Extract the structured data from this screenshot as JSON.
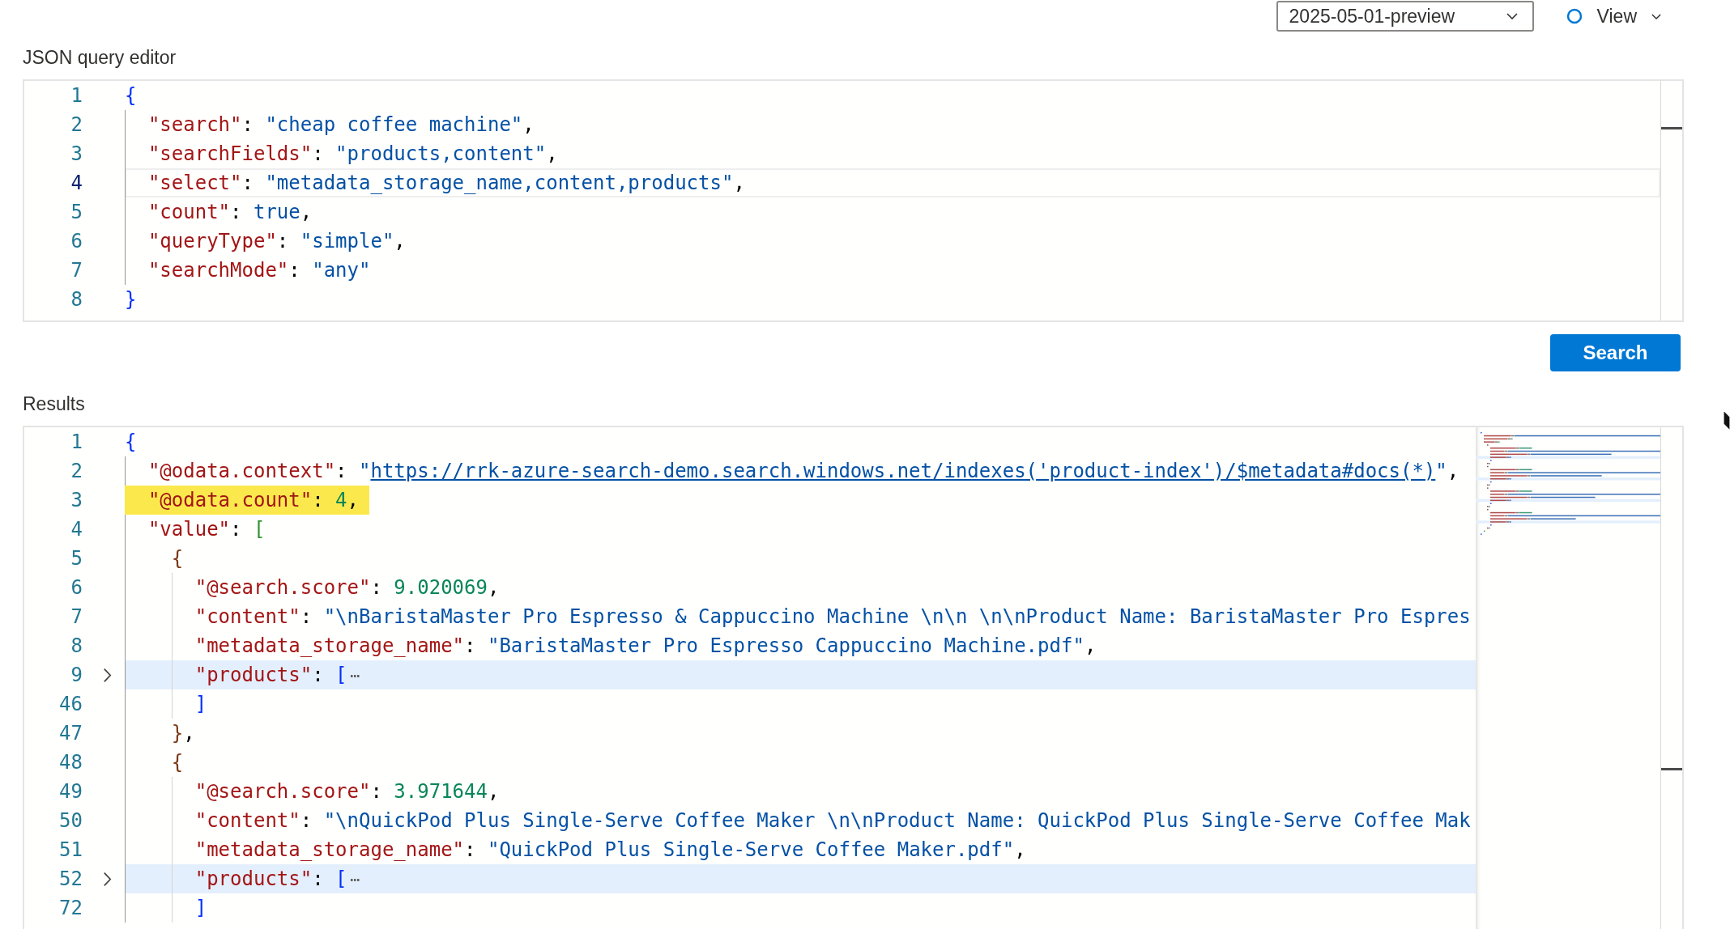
{
  "toolbar": {
    "api_version_dropdown": {
      "value": "2025-05-01-preview"
    },
    "view_menu": {
      "label": "View"
    }
  },
  "query_editor": {
    "label": "JSON query editor",
    "lines": [
      {
        "number": "1",
        "current": false,
        "tokens": [
          {
            "kind": "bracket",
            "text": "{",
            "color": "#0431fa"
          }
        ]
      },
      {
        "number": "2",
        "current": false,
        "tokens": [
          {
            "kind": "key",
            "text": "  \"search\""
          },
          {
            "kind": "punct",
            "text": ": "
          },
          {
            "kind": "string",
            "text": "\"cheap coffee machine\""
          },
          {
            "kind": "punct",
            "text": ","
          }
        ]
      },
      {
        "number": "3",
        "current": false,
        "tokens": [
          {
            "kind": "key",
            "text": "  \"searchFields\""
          },
          {
            "kind": "punct",
            "text": ": "
          },
          {
            "kind": "string",
            "text": "\"products,content\""
          },
          {
            "kind": "punct",
            "text": ","
          }
        ]
      },
      {
        "number": "4",
        "current": true,
        "tokens": [
          {
            "kind": "key",
            "text": "  \"select\""
          },
          {
            "kind": "punct",
            "text": ": "
          },
          {
            "kind": "string",
            "text": "\"metadata_storage_name,content,products\""
          },
          {
            "kind": "punct",
            "text": ","
          }
        ]
      },
      {
        "number": "5",
        "current": false,
        "tokens": [
          {
            "kind": "key",
            "text": "  \"count\""
          },
          {
            "kind": "punct",
            "text": ": "
          },
          {
            "kind": "keyword",
            "text": "true"
          },
          {
            "kind": "punct",
            "text": ","
          }
        ]
      },
      {
        "number": "6",
        "current": false,
        "tokens": [
          {
            "kind": "key",
            "text": "  \"queryType\""
          },
          {
            "kind": "punct",
            "text": ": "
          },
          {
            "kind": "string",
            "text": "\"simple\""
          },
          {
            "kind": "punct",
            "text": ","
          }
        ]
      },
      {
        "number": "7",
        "current": false,
        "tokens": [
          {
            "kind": "key",
            "text": "  \"searchMode\""
          },
          {
            "kind": "punct",
            "text": ": "
          },
          {
            "kind": "string",
            "text": "\"any\""
          }
        ]
      },
      {
        "number": "8",
        "current": false,
        "tokens": [
          {
            "kind": "bracket",
            "text": "}",
            "color": "#0431fa"
          }
        ]
      }
    ]
  },
  "search_button": {
    "label": "Search"
  },
  "results": {
    "label": "Results",
    "lines": [
      {
        "number": "1",
        "folded": false,
        "highlighted": false,
        "tokens": [
          {
            "kind": "bracket",
            "text": "{",
            "color": "#0431fa"
          }
        ]
      },
      {
        "number": "2",
        "folded": false,
        "highlighted": false,
        "tokens": [
          {
            "kind": "key",
            "text": "  \"@odata.context\""
          },
          {
            "kind": "punct",
            "text": ": "
          },
          {
            "kind": "string",
            "text": "\""
          },
          {
            "kind": "link",
            "text": "https://rrk-azure-search-demo.search.windows.net/indexes('product-index')/$metadata#docs(*)"
          },
          {
            "kind": "string",
            "text": "\""
          },
          {
            "kind": "punct",
            "text": ","
          }
        ]
      },
      {
        "number": "3",
        "folded": false,
        "highlighted": true,
        "tokens": [
          {
            "kind": "key",
            "text": "  \"@odata.count\""
          },
          {
            "kind": "punct",
            "text": ": "
          },
          {
            "kind": "number",
            "text": "4"
          },
          {
            "kind": "punct",
            "text": ","
          }
        ]
      },
      {
        "number": "4",
        "folded": false,
        "highlighted": false,
        "tokens": [
          {
            "kind": "key",
            "text": "  \"value\""
          },
          {
            "kind": "punct",
            "text": ": "
          },
          {
            "kind": "bracket",
            "text": "[",
            "color": "#319331"
          }
        ]
      },
      {
        "number": "5",
        "folded": false,
        "highlighted": false,
        "tokens": [
          {
            "kind": "bracket",
            "text": "    {",
            "color": "#7b3814"
          }
        ]
      },
      {
        "number": "6",
        "folded": false,
        "highlighted": false,
        "tokens": [
          {
            "kind": "key",
            "text": "      \"@search.score\""
          },
          {
            "kind": "punct",
            "text": ": "
          },
          {
            "kind": "number",
            "text": "9.020069"
          },
          {
            "kind": "punct",
            "text": ","
          }
        ]
      },
      {
        "number": "7",
        "folded": false,
        "highlighted": false,
        "tokens": [
          {
            "kind": "key",
            "text": "      \"content\""
          },
          {
            "kind": "punct",
            "text": ": "
          },
          {
            "kind": "string",
            "text": "\"\\nBaristaMaster Pro Espresso & Cappuccino Machine \\n\\n \\n\\nProduct Name: BaristaMaster Pro Espres"
          }
        ]
      },
      {
        "number": "8",
        "folded": false,
        "highlighted": false,
        "tokens": [
          {
            "kind": "key",
            "text": "      \"metadata_storage_name\""
          },
          {
            "kind": "punct",
            "text": ": "
          },
          {
            "kind": "string",
            "text": "\"BaristaMaster Pro Espresso Cappuccino Machine.pdf\""
          },
          {
            "kind": "punct",
            "text": ","
          }
        ]
      },
      {
        "number": "9",
        "folded": true,
        "highlighted": false,
        "tokens": [
          {
            "kind": "key",
            "text": "      \"products\""
          },
          {
            "kind": "punct",
            "text": ": "
          },
          {
            "kind": "bracket",
            "text": "[",
            "color": "#0431fa"
          },
          {
            "kind": "fold",
            "text": "⋯"
          }
        ]
      },
      {
        "number": "46",
        "folded": false,
        "highlighted": false,
        "tokens": [
          {
            "kind": "bracket",
            "text": "      ]",
            "color": "#0431fa"
          }
        ]
      },
      {
        "number": "47",
        "folded": false,
        "highlighted": false,
        "tokens": [
          {
            "kind": "bracket",
            "text": "    }",
            "color": "#7b3814"
          },
          {
            "kind": "punct",
            "text": ","
          }
        ]
      },
      {
        "number": "48",
        "folded": false,
        "highlighted": false,
        "tokens": [
          {
            "kind": "bracket",
            "text": "    {",
            "color": "#7b3814"
          }
        ]
      },
      {
        "number": "49",
        "folded": false,
        "highlighted": false,
        "tokens": [
          {
            "kind": "key",
            "text": "      \"@search.score\""
          },
          {
            "kind": "punct",
            "text": ": "
          },
          {
            "kind": "number",
            "text": "3.971644"
          },
          {
            "kind": "punct",
            "text": ","
          }
        ]
      },
      {
        "number": "50",
        "folded": false,
        "highlighted": false,
        "tokens": [
          {
            "kind": "key",
            "text": "      \"content\""
          },
          {
            "kind": "punct",
            "text": ": "
          },
          {
            "kind": "string",
            "text": "\"\\nQuickPod Plus Single-Serve Coffee Maker \\n\\nProduct Name: QuickPod Plus Single-Serve Coffee Mak"
          }
        ]
      },
      {
        "number": "51",
        "folded": false,
        "highlighted": false,
        "tokens": [
          {
            "kind": "key",
            "text": "      \"metadata_storage_name\""
          },
          {
            "kind": "punct",
            "text": ": "
          },
          {
            "kind": "string",
            "text": "\"QuickPod Plus Single-Serve Coffee Maker.pdf\""
          },
          {
            "kind": "punct",
            "text": ","
          }
        ]
      },
      {
        "number": "52",
        "folded": true,
        "highlighted": false,
        "tokens": [
          {
            "kind": "key",
            "text": "      \"products\""
          },
          {
            "kind": "punct",
            "text": ": "
          },
          {
            "kind": "bracket",
            "text": "[",
            "color": "#0431fa"
          },
          {
            "kind": "fold",
            "text": "⋯"
          }
        ]
      },
      {
        "number": "72",
        "folded": false,
        "highlighted": false,
        "tokens": [
          {
            "kind": "bracket",
            "text": "      ]",
            "color": "#0431fa"
          }
        ]
      }
    ]
  }
}
